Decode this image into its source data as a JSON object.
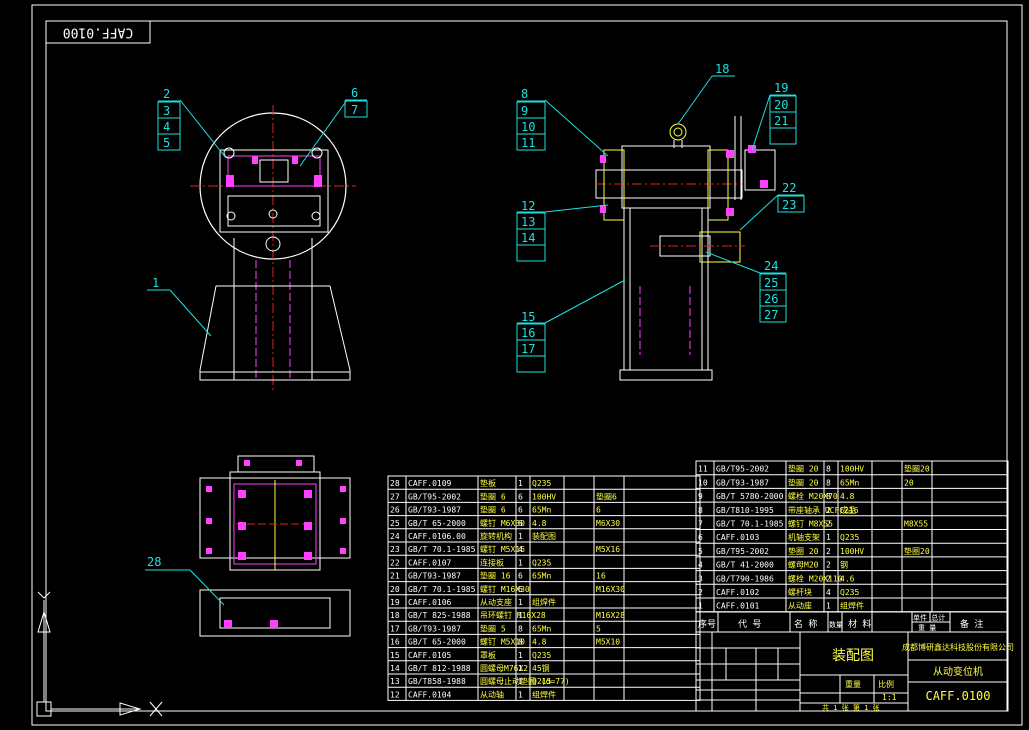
{
  "drawing_code_rotated": "CAFF.0100",
  "view1_balloons": [
    "1",
    "2",
    "3",
    "4",
    "5",
    "6",
    "7"
  ],
  "view2_balloons": [
    "8",
    "9",
    "10",
    "11",
    "12",
    "13",
    "14",
    "15",
    "16",
    "17",
    "18",
    "19",
    "20",
    "21",
    "22",
    "23",
    "24",
    "25",
    "26",
    "27"
  ],
  "view3_balloons": [
    "28"
  ],
  "bom_left": [
    {
      "no": "28",
      "code": "CAFF.0109",
      "name": "垫板",
      "qty": "1",
      "mat": "Q235",
      "wt": "",
      "note": ""
    },
    {
      "no": "27",
      "code": "GB/T95-2002",
      "name": "垫圈 6",
      "qty": "6",
      "mat": "100HV",
      "wt": "",
      "note": "垫圈6"
    },
    {
      "no": "26",
      "code": "GB/T93-1987",
      "name": "垫圈 6",
      "qty": "6",
      "mat": "65Mn",
      "wt": "",
      "note": "6"
    },
    {
      "no": "25",
      "code": "GB/T 65-2000",
      "name": "螺钉 M6X30",
      "qty": "6",
      "mat": "4.8",
      "wt": "",
      "note": "M6X30"
    },
    {
      "no": "24",
      "code": "CAFF.0106.00",
      "name": "旋转机构",
      "qty": "1",
      "mat": "装配图",
      "wt": "",
      "note": ""
    },
    {
      "no": "23",
      "code": "GB/T 70.1-1985",
      "name": "螺钉 M5X16",
      "qty": "4",
      "mat": "",
      "wt": "",
      "note": "M5X16"
    },
    {
      "no": "22",
      "code": "CAFF.0107",
      "name": "连接板",
      "qty": "1",
      "mat": "Q235",
      "wt": "",
      "note": ""
    },
    {
      "no": "21",
      "code": "GB/T93-1987",
      "name": "垫圈 16",
      "qty": "6",
      "mat": "65Mn",
      "wt": "",
      "note": "16"
    },
    {
      "no": "20",
      "code": "GB/T 70.1-1985",
      "name": "螺钉 M16X30",
      "qty": "6",
      "mat": "",
      "wt": "",
      "note": "M16X30"
    },
    {
      "no": "19",
      "code": "CAFF.0106",
      "name": "从动支座",
      "qty": "1",
      "mat": "组焊件",
      "wt": "",
      "note": ""
    },
    {
      "no": "18",
      "code": "GB/T 825-1988",
      "name": "吊环螺钉 M16X28",
      "qty": "1",
      "mat": "",
      "wt": "",
      "note": "M16X28"
    },
    {
      "no": "17",
      "code": "GB/T93-1987",
      "name": "垫圈 5",
      "qty": "8",
      "mat": "65Mn",
      "wt": "",
      "note": "5"
    },
    {
      "no": "16",
      "code": "GB/T 65-2000",
      "name": "螺钉 M5X10",
      "qty": "8",
      "mat": "4.8",
      "wt": "",
      "note": "M5X10"
    },
    {
      "no": "15",
      "code": "CAFF.0105",
      "name": "罩板",
      "qty": "1",
      "mat": "Q235",
      "wt": "",
      "note": ""
    },
    {
      "no": "14",
      "code": "GB/T 812-1988",
      "name": "圆螺母M76X2",
      "qty": "1",
      "mat": "45钢",
      "wt": "",
      "note": ""
    },
    {
      "no": "13",
      "code": "GB/T858-1988",
      "name": "圆螺母止动垫圈 (d=77)",
      "qty": "1",
      "mat": "Q215",
      "wt": "",
      "note": ""
    },
    {
      "no": "12",
      "code": "CAFF.0104",
      "name": "从动轴",
      "qty": "1",
      "mat": "组焊件",
      "wt": "",
      "note": ""
    }
  ],
  "bom_right": [
    {
      "no": "11",
      "code": "GB/T95-2002",
      "name": "垫圈 20",
      "qty": "8",
      "mat": "100HV",
      "wt": "",
      "note": "垫圈20"
    },
    {
      "no": "10",
      "code": "GB/T93-1987",
      "name": "垫圈 20",
      "qty": "8",
      "mat": "65Mn",
      "wt": "",
      "note": "20"
    },
    {
      "no": "9",
      "code": "GB/T 5780-2000",
      "name": "螺栓 M20X70",
      "qty": "8",
      "mat": "4.8",
      "wt": "",
      "note": ""
    },
    {
      "no": "8",
      "code": "GB/T810-1995",
      "name": "带座轴承 UCFC216",
      "qty": "2",
      "mat": "成品",
      "wt": "",
      "note": ""
    },
    {
      "no": "7",
      "code": "GB/T 70.1-1985",
      "name": "螺钉 M8X55",
      "qty": "2",
      "mat": "",
      "wt": "",
      "note": "M8X55"
    },
    {
      "no": "6",
      "code": "CAFF.0103",
      "name": "机轴支架",
      "qty": "1",
      "mat": "Q235",
      "wt": "",
      "note": ""
    },
    {
      "no": "5",
      "code": "GB/T95-2002",
      "name": "垫圈 20",
      "qty": "2",
      "mat": "100HV",
      "wt": "",
      "note": "垫圈20"
    },
    {
      "no": "4",
      "code": "GB/T 41-2000",
      "name": "螺母M20",
      "qty": "2",
      "mat": "钢",
      "wt": "",
      "note": ""
    },
    {
      "no": "3",
      "code": "GB/T790-1986",
      "name": "螺栓 M20X110",
      "qty": "2",
      "mat": "4.6",
      "wt": "",
      "note": ""
    },
    {
      "no": "2",
      "code": "CAFF.0102",
      "name": "螺杆块",
      "qty": "4",
      "mat": "Q235",
      "wt": "",
      "note": ""
    },
    {
      "no": "1",
      "code": "CAFF.0101",
      "name": "从动座",
      "qty": "1",
      "mat": "组焊件",
      "wt": "",
      "note": ""
    }
  ],
  "bom_header": {
    "no": "序号",
    "code": "代 号",
    "name": "名 称",
    "qty": "数量",
    "mat": "材 料",
    "wt": "单件 总计",
    "wt2": "重 量",
    "note": "备 注"
  },
  "title_block": {
    "drawing_type": "装配图",
    "company": "成都博研鑫达科技股份有限公司",
    "product": "从动变位机",
    "code": "CAFF.0100",
    "scale_label": "比例",
    "scale": "1:1",
    "sheet_info": "共 1 张  第 1 张",
    "weight_label": "重量"
  }
}
